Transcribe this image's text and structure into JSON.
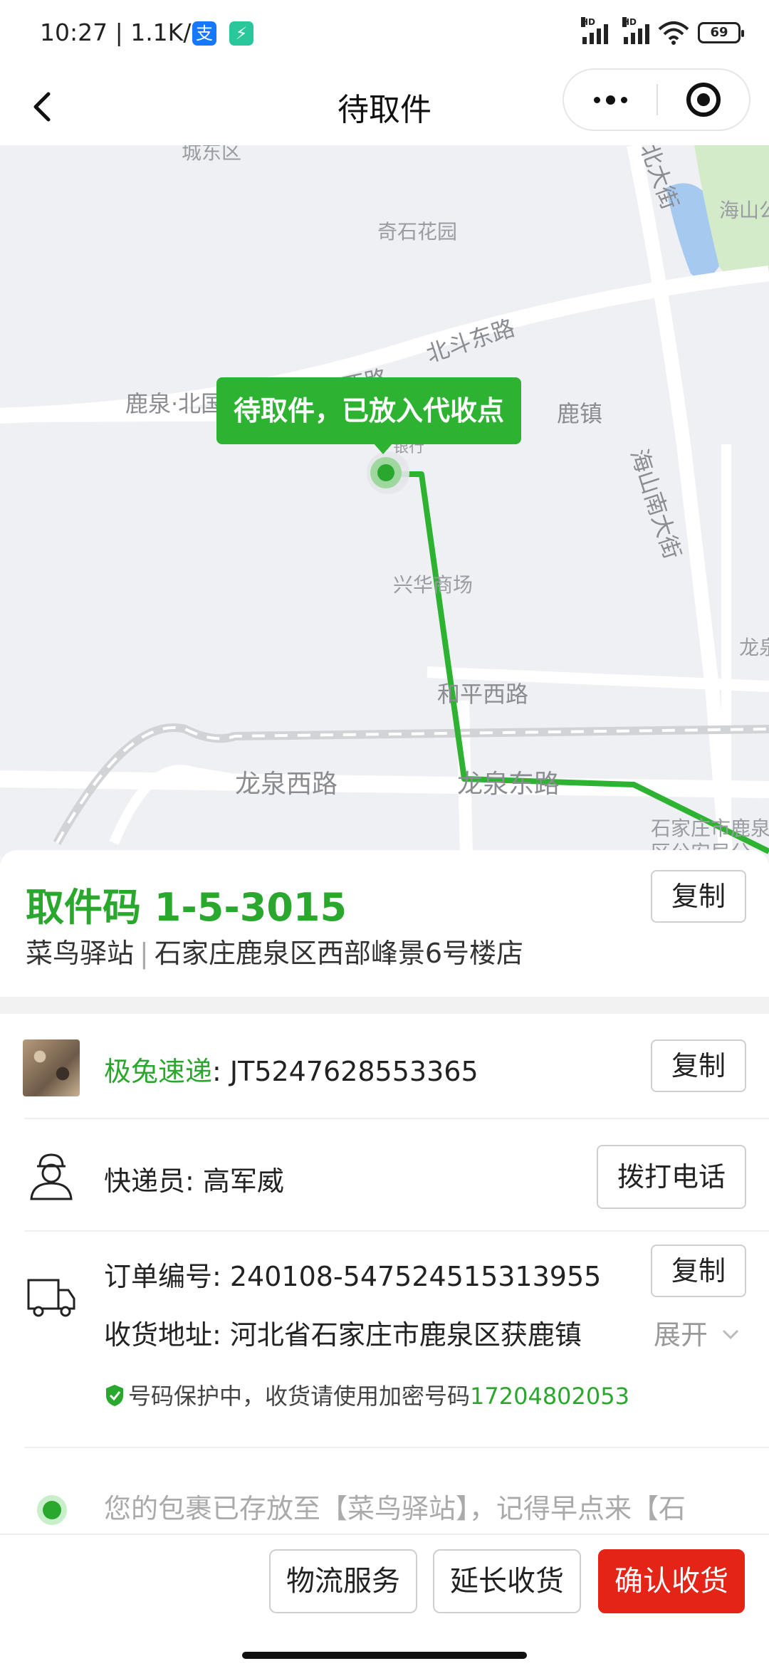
{
  "status_bar": {
    "time": "10:27 | 1.1K/s",
    "battery": "69",
    "hd_label": "HD",
    "app_icon_1": "alipay-icon",
    "app_icon_2": "power-app-icon"
  },
  "nav": {
    "title": "待取件",
    "back_icon": "chevron-left-icon",
    "more_icon": "more-dots-icon",
    "close_icon": "target-icon"
  },
  "map": {
    "status_bubble": "待取件，已放入代收点",
    "labels": {
      "chengdong": "城东区",
      "qishi": "奇石花园",
      "haishan_park": "海山公",
      "beida_jie": "北大街",
      "beidou": "北斗东路",
      "luquan_bei": "鹿泉·北国",
      "xilu": "西路",
      "luzhen": "鹿镇",
      "yinhang": "银行",
      "haishan_nan": "海山南大街",
      "xinghua": "兴华商场",
      "long": "龙泉",
      "heping": "和平西路",
      "longquan_xi": "龙泉西路",
      "longquan_dong": "龙泉东路",
      "gov": "石家庄市鹿泉区公安局",
      "gov2": "区公安局分"
    },
    "route_color": "#2eb232"
  },
  "pickup": {
    "code": "取件码 1-5-3015",
    "station": "菜鸟驿站",
    "separator": "|",
    "address": "石家庄鹿泉区西部峰景6号楼店",
    "copy_label": "复制"
  },
  "detail": {
    "courier_company": "极兔速递",
    "tracking_number": ": JT5247628553365",
    "copy_label": "复制",
    "courier_label": "快递员: 高军威",
    "call_label": "拨打电话",
    "order_label": "订单编号: 240108-547524515313955",
    "address_label": "收货地址: 河北省石家庄市鹿泉区获鹿镇",
    "expand_label": "展开",
    "privacy_text": "号码保护中，收货请使用加密号码",
    "privacy_number": "17204802053",
    "track_text": "您的包裹已存放至【菜鸟驿站】，记得早点来【石"
  },
  "bottom": {
    "logistics": "物流服务",
    "extend": "延长收货",
    "confirm": "确认收货",
    "confirm_color": "#e42416"
  }
}
